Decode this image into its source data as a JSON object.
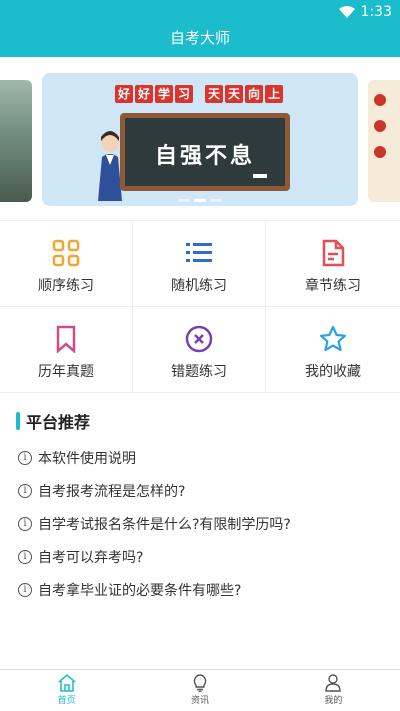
{
  "status": {
    "time": "1:33"
  },
  "header": {
    "title": "自考大师"
  },
  "banner": {
    "motto_left": [
      "好",
      "好",
      "学",
      "习"
    ],
    "motto_right": [
      "天",
      "天",
      "向",
      "上"
    ],
    "board_text": "自强不息"
  },
  "grid": {
    "items": [
      {
        "label": "顺序练习",
        "icon": "grid-icon",
        "color": "#f2a531"
      },
      {
        "label": "随机练习",
        "icon": "list-icon",
        "color": "#2a6fc9"
      },
      {
        "label": "章节练习",
        "icon": "document-icon",
        "color": "#e2504f"
      },
      {
        "label": "历年真题",
        "icon": "bookmark-icon",
        "color": "#d04b8a"
      },
      {
        "label": "错题练习",
        "icon": "x-circle-icon",
        "color": "#7a3fb0"
      },
      {
        "label": "我的收藏",
        "icon": "star-icon",
        "color": "#2aa3e6"
      }
    ]
  },
  "recommend": {
    "title": "平台推荐",
    "items": [
      "本软件使用说明",
      "自考报考流程是怎样的?",
      "自学考试报名条件是什么?有限制学历吗?",
      "自考可以弃考吗?",
      "自考拿毕业证的必要条件有哪些?"
    ],
    "info_glyph": "i"
  },
  "nav": {
    "items": [
      {
        "label": "首页",
        "icon": "home-icon",
        "active": true
      },
      {
        "label": "资讯",
        "icon": "lightbulb-icon",
        "active": false
      },
      {
        "label": "我的",
        "icon": "user-icon",
        "active": false
      }
    ]
  },
  "colors": {
    "accent": "#1bbccc"
  }
}
